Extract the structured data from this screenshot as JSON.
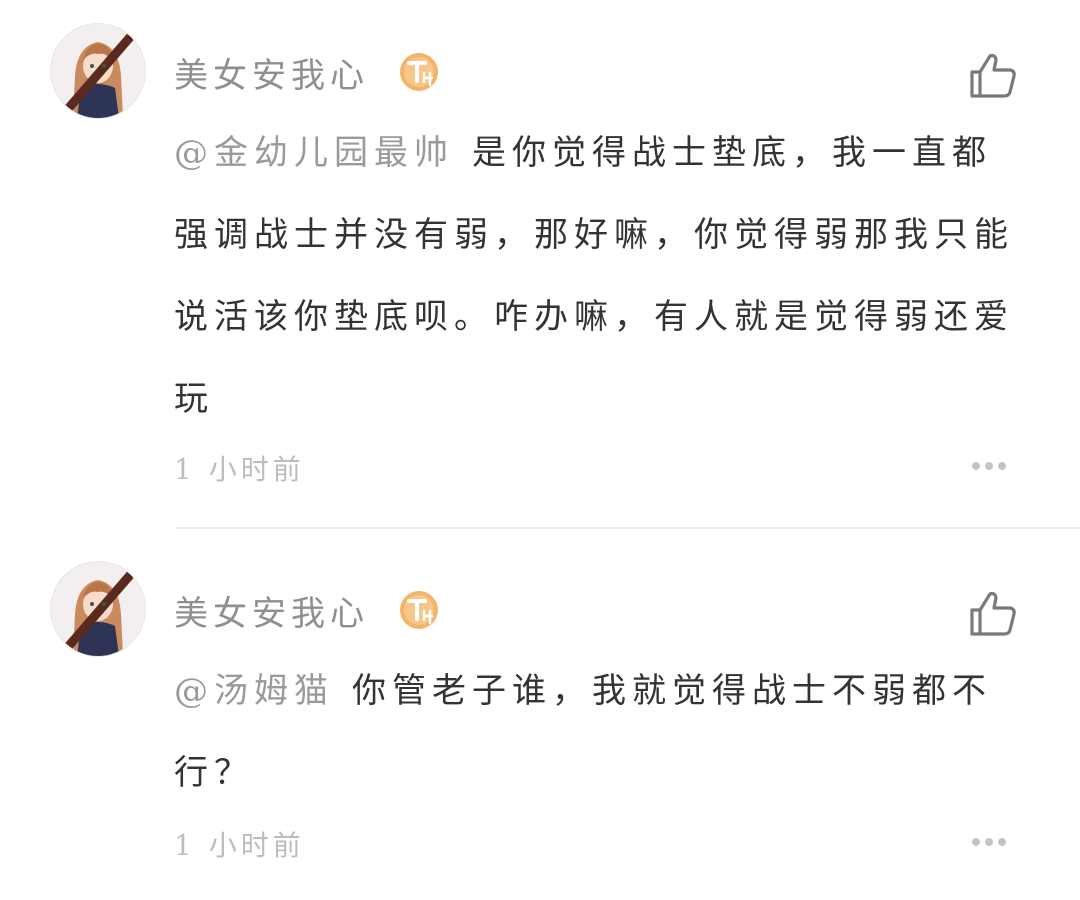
{
  "colors": {
    "username": "#8f8f8f",
    "body_text": "#333333",
    "mention": "#9a9a9a",
    "timestamp": "#bdbdbd",
    "badge": "#f3b469",
    "like_icon": "#7a7a7a",
    "more_icon": "#c4c4c4",
    "divider": "#ececec"
  },
  "comments": [
    {
      "username": "美女安我心",
      "badge_icon": "level-badge-icon",
      "mention": "@金幼儿园最帅",
      "text": "是你觉得战士垫底，我一直都强调战士并没有弱，那好嘛，你觉得弱那我只能说活该你垫底呗。咋办嘛，有人就是觉得弱还爱玩",
      "time": "1 小时前",
      "like_icon": "thumbs-up-icon",
      "more_icon": "more-dots-icon"
    },
    {
      "username": "美女安我心",
      "badge_icon": "level-badge-icon",
      "mention": "@汤姆猫",
      "text": "你管老子谁，我就觉得战士不弱都不行？",
      "time": "1 小时前",
      "like_icon": "thumbs-up-icon",
      "more_icon": "more-dots-icon"
    }
  ]
}
